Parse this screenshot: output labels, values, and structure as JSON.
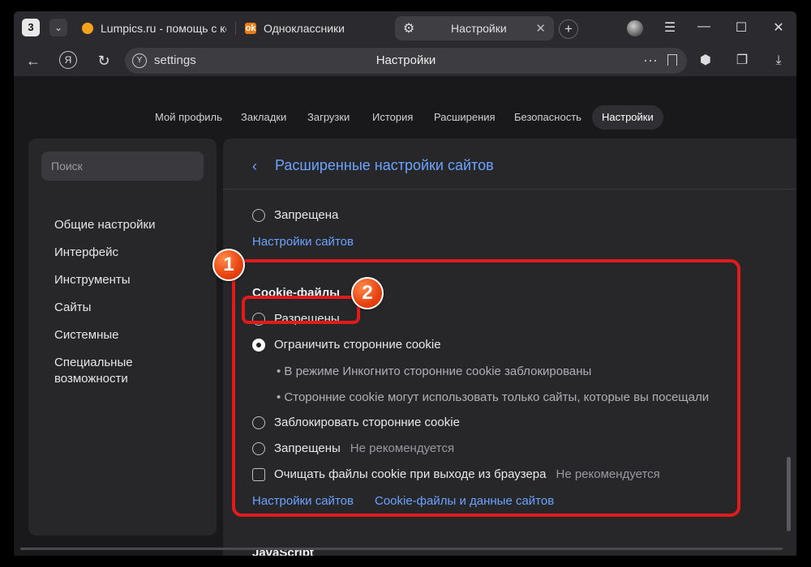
{
  "browser": {
    "tab_count": "3",
    "tabs": [
      {
        "title": "Lumpics.ru - помощь с ко"
      },
      {
        "title": "Одноклассники"
      },
      {
        "title": "Настройки"
      }
    ],
    "address": {
      "url": "settings",
      "page_title": "Настройки"
    }
  },
  "topnav": {
    "items": [
      "Мой профиль",
      "Закладки",
      "Загрузки",
      "История",
      "Расширения",
      "Безопасность",
      "Настройки"
    ],
    "active": "Настройки"
  },
  "sidebar": {
    "search_placeholder": "Поиск",
    "items": [
      "Общие настройки",
      "Интерфейс",
      "Инструменты",
      "Сайты",
      "Системные",
      "Специальные возможности"
    ]
  },
  "main": {
    "title": "Расширенные настройки сайтов",
    "prev_option": "Запрещена",
    "prev_link": "Настройки сайтов",
    "cookie": {
      "heading": "Cookie-файлы",
      "opt_allowed": "Разрешены",
      "opt_limit": "Ограничить сторонние cookie",
      "limit_note1": "• В режиме Инкогнито сторонние cookie заблокированы",
      "limit_note2": "• Сторонние cookie могут использовать только сайты, которые вы посещали",
      "opt_block": "Заблокировать сторонние cookie",
      "opt_denied": "Запрещены",
      "not_recommended": "Не рекомендуется",
      "clear_on_exit": "Очищать файлы cookie при выходе из браузера",
      "link_site_settings": "Настройки сайтов",
      "link_cookie_data": "Cookie-файлы и данные сайтов",
      "selected": "opt_limit"
    },
    "next_heading": "JavaScript"
  },
  "annotations": {
    "badge1": "1",
    "badge2": "2",
    "color": "#e11b1b"
  }
}
